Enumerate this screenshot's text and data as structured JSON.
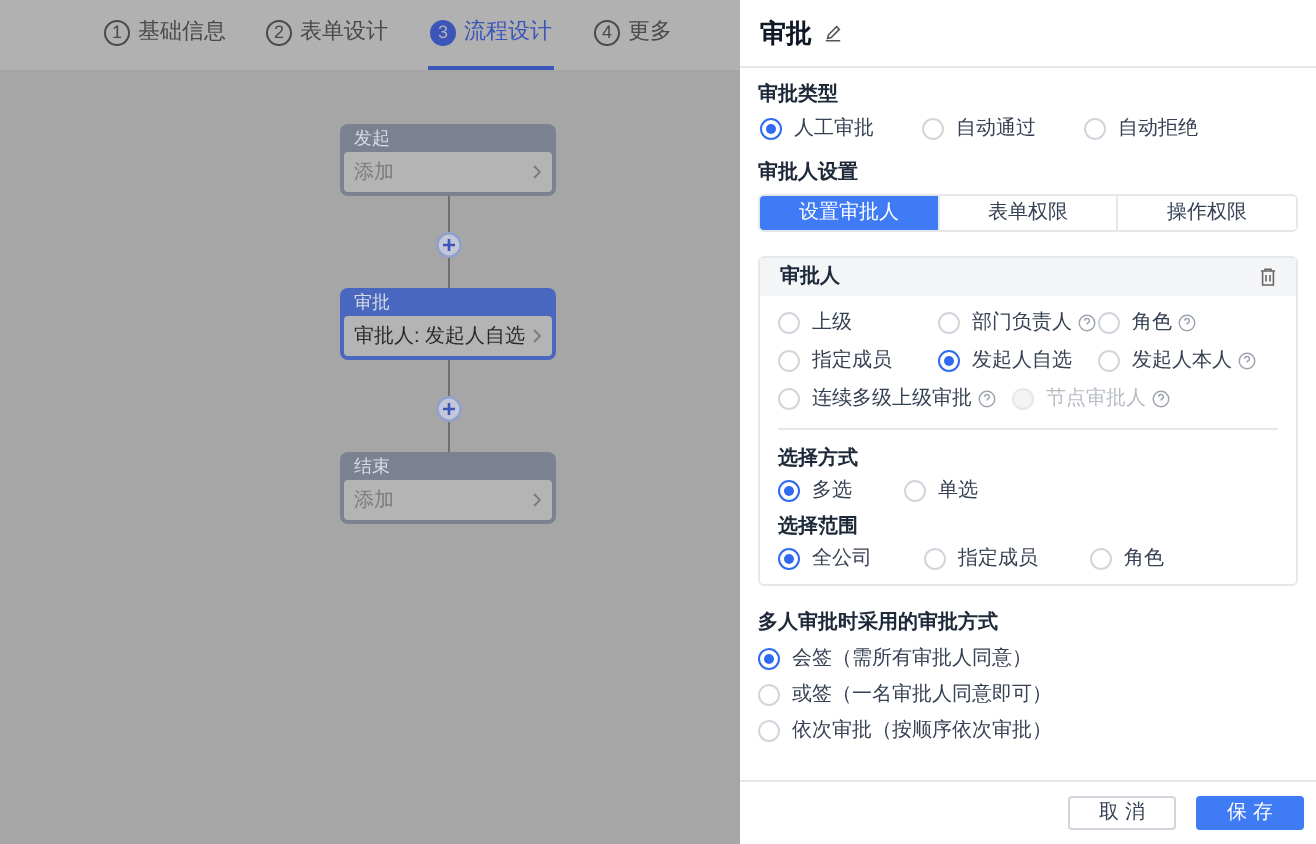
{
  "steps": [
    {
      "number": "1",
      "label": "基础信息",
      "selected": false
    },
    {
      "number": "2",
      "label": "表单设计",
      "selected": false
    },
    {
      "number": "3",
      "label": "流程设计",
      "selected": true
    },
    {
      "number": "4",
      "label": "更多",
      "selected": false
    }
  ],
  "flow": {
    "nodes": [
      {
        "title": "发起",
        "content": "添加",
        "selected": false
      },
      {
        "title": "审批",
        "content": "审批人: 发起人自选",
        "selected": true
      },
      {
        "title": "结束",
        "content": "添加",
        "selected": false
      }
    ]
  },
  "drawer": {
    "title": "审批",
    "approval_type": {
      "label": "审批类型",
      "options": [
        {
          "label": "人工审批",
          "selected": true
        },
        {
          "label": "自动通过",
          "selected": false
        },
        {
          "label": "自动拒绝",
          "selected": false
        }
      ]
    },
    "approver_settings": {
      "label": "审批人设置",
      "tabs": [
        {
          "label": "设置审批人",
          "selected": true
        },
        {
          "label": "表单权限",
          "selected": false
        },
        {
          "label": "操作权限",
          "selected": false
        }
      ],
      "card": {
        "title": "审批人",
        "options": [
          {
            "label": "上级",
            "selected": false,
            "help": false,
            "disabled": false
          },
          {
            "label": "部门负责人",
            "selected": false,
            "help": true,
            "disabled": false
          },
          {
            "label": "角色",
            "selected": false,
            "help": true,
            "disabled": false
          },
          {
            "label": "指定成员",
            "selected": false,
            "help": false,
            "disabled": false
          },
          {
            "label": "发起人自选",
            "selected": true,
            "help": false,
            "disabled": false
          },
          {
            "label": "发起人本人",
            "selected": false,
            "help": true,
            "disabled": false
          },
          {
            "label": "连续多级上级审批",
            "selected": false,
            "help": true,
            "disabled": false
          },
          {
            "label": "节点审批人",
            "selected": false,
            "help": true,
            "disabled": true
          }
        ],
        "selection_mode": {
          "label": "选择方式",
          "options": [
            {
              "label": "多选",
              "selected": true
            },
            {
              "label": "单选",
              "selected": false
            }
          ]
        },
        "scope": {
          "label": "选择范围",
          "options": [
            {
              "label": "全公司",
              "selected": true
            },
            {
              "label": "指定成员",
              "selected": false
            },
            {
              "label": "角色",
              "selected": false
            }
          ]
        }
      }
    },
    "multi_approval": {
      "label": "多人审批时采用的审批方式",
      "options": [
        {
          "label": "会签（需所有审批人同意）",
          "selected": true
        },
        {
          "label": "或签（一名审批人同意即可）",
          "selected": false
        },
        {
          "label": "依次审批（按顺序依次审批）",
          "selected": false
        }
      ]
    },
    "buttons": [
      {
        "label": "取 消",
        "kind": "secondary"
      },
      {
        "label": "保 存",
        "kind": "primary"
      }
    ]
  }
}
